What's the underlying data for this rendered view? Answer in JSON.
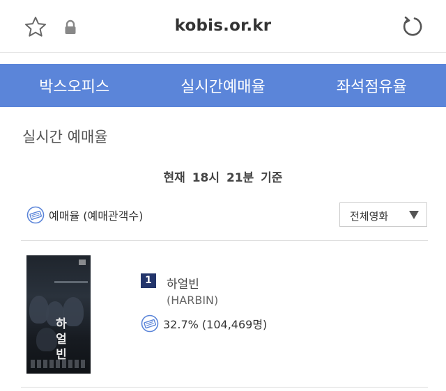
{
  "browser": {
    "url": "kobis.or.kr",
    "icons": [
      "star-icon",
      "lock-icon",
      "reload-icon"
    ]
  },
  "nav": {
    "tabs": [
      {
        "label": "박스오피스"
      },
      {
        "label": "실시간예매율"
      },
      {
        "label": "좌석점유율"
      }
    ]
  },
  "page": {
    "title": "실시간 예매율",
    "basis": "현재 18시 21분 기준",
    "legend": "예매율 (예매관객수)",
    "filter": {
      "selected": "전체영화"
    }
  },
  "movies": [
    {
      "rank": "1",
      "title": "하얼빈",
      "subtitle": "(HARBIN)",
      "rate": "32.7% (104,469명)",
      "poster_title": "하\n얼\n빈"
    }
  ],
  "colors": {
    "tab_bar": "#5b85d9",
    "rank_badge": "#23356b",
    "ticket_icon": "#5b85d9"
  }
}
